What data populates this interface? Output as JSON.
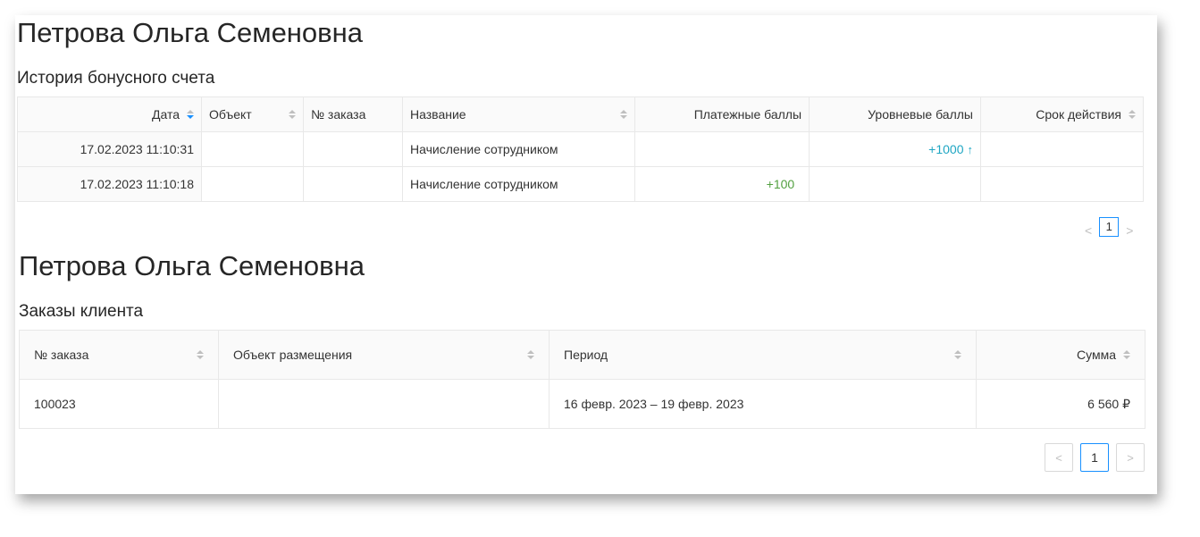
{
  "bonus": {
    "client_name": "Петрова Ольга Семеновна",
    "section_title": "История бонусного счета",
    "columns": {
      "date": "Дата",
      "object": "Объект",
      "order": "№ заказа",
      "name": "Название",
      "payment_points": "Платежные баллы",
      "level_points": "Уровневые баллы",
      "expiry": "Срок действия"
    },
    "rows": [
      {
        "date": "17.02.2023 11:10:31",
        "object": "",
        "order": "",
        "name": "Начисление сотрудником",
        "payment_points": "",
        "level_points": "+1000",
        "expiry": ""
      },
      {
        "date": "17.02.2023 11:10:18",
        "object": "",
        "order": "",
        "name": "Начисление сотрудником",
        "payment_points": "+100",
        "level_points": "",
        "expiry": ""
      }
    ],
    "pagination": {
      "prev": "<",
      "page": "1",
      "next": ">"
    }
  },
  "orders": {
    "client_name": "Петрова Ольга Семеновна",
    "section_title": "Заказы клиента",
    "columns": {
      "order": "№ заказа",
      "object": "Объект размещения",
      "period": "Период",
      "sum": "Сумма"
    },
    "rows": [
      {
        "order": "100023",
        "object": "",
        "period": "16 февр. 2023 – 19 февр. 2023",
        "sum": "6 560 ₽"
      }
    ],
    "pagination": {
      "prev": "<",
      "page": "1",
      "next": ">"
    }
  },
  "colors": {
    "accent": "#1890ff",
    "level_points": "#1fa6c3",
    "payment_points": "#52a040"
  },
  "icons": {
    "sort": "sort-caret-icon",
    "level_up": "arrow-up-icon"
  }
}
